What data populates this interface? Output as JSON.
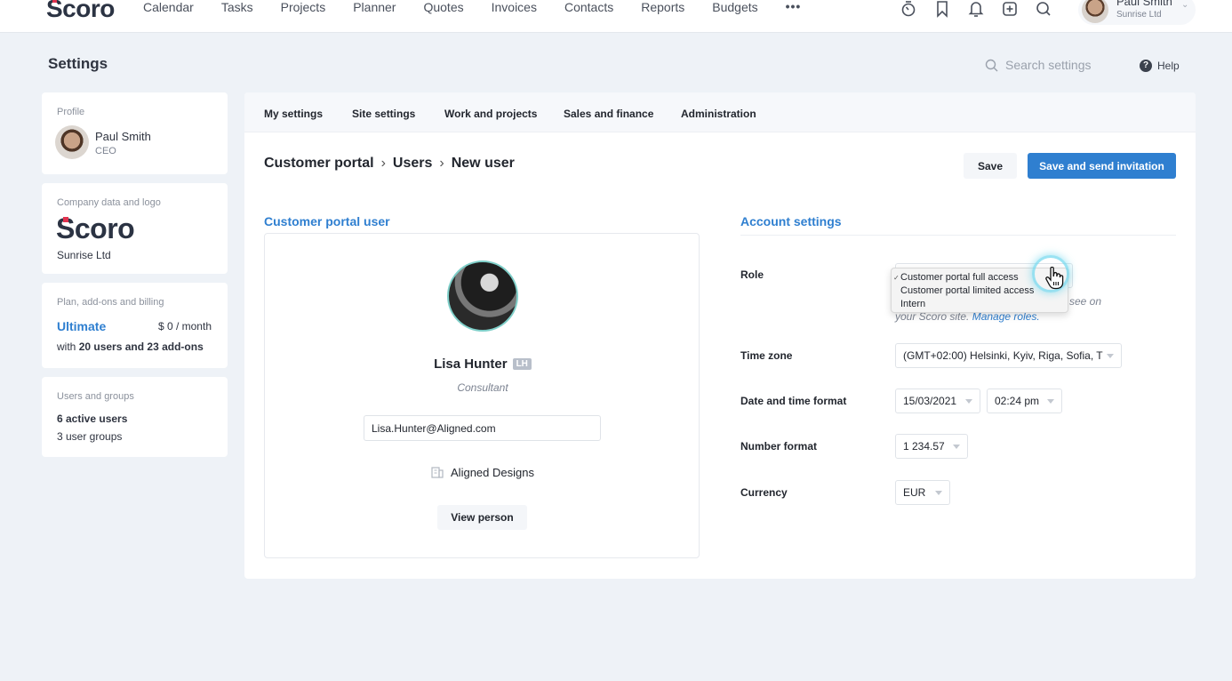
{
  "topnav": {
    "logo": "Scoro",
    "items": [
      "Calendar",
      "Tasks",
      "Projects",
      "Planner",
      "Quotes",
      "Invoices",
      "Contacts",
      "Reports",
      "Budgets"
    ],
    "more": "•••",
    "icons": [
      "stopwatch-icon",
      "bookmark-icon",
      "bell-icon",
      "add-icon",
      "search-icon"
    ],
    "user": {
      "name": "Paul Smith",
      "company": "Sunrise Ltd"
    }
  },
  "header": {
    "title": "Settings",
    "search_placeholder": "Search settings",
    "help": "Help"
  },
  "sidebar": {
    "profile": {
      "label": "Profile",
      "name": "Paul Smith",
      "role": "CEO"
    },
    "company": {
      "label": "Company data and logo",
      "logo": "Scoro",
      "name": "Sunrise Ltd"
    },
    "plan": {
      "label": "Plan, add-ons and billing",
      "name": "Ultimate",
      "price": "$ 0 / month",
      "desc_prefix": "with ",
      "desc_bold": "20 users and 23 add-ons"
    },
    "users": {
      "label": "Users and groups",
      "active": "6 active users",
      "groups": "3 user groups"
    }
  },
  "tabs": [
    "My settings",
    "Site settings",
    "Work and projects",
    "Sales and finance",
    "Administration"
  ],
  "breadcrumb": [
    "Customer portal",
    "Users",
    "New user"
  ],
  "breadcrumb_sep": "›",
  "actions": {
    "save": "Save",
    "save_invite": "Save and send invitation"
  },
  "portal_user": {
    "section_title": "Customer portal user",
    "name": "Lisa Hunter",
    "initials": "LH",
    "role": "Consultant",
    "email": "Lisa.Hunter@Aligned.com",
    "company": "Aligned Designs",
    "view_button": "View person"
  },
  "account": {
    "section_title": "Account settings",
    "role_label": "Role",
    "role_desc_suffix": "see on",
    "role_desc_line2": "your Scoro site. ",
    "manage_roles": "Manage roles.",
    "role_options": [
      "Customer portal full access",
      "Customer portal limited access",
      "Intern"
    ],
    "role_selected_check": "✓",
    "timezone_label": "Time zone",
    "timezone": "(GMT+02:00) Helsinki, Kyiv, Riga, Sofia, T",
    "datetime_label": "Date and time format",
    "date_format": "15/03/2021",
    "time_format": "02:24 pm",
    "number_label": "Number format",
    "number_format": "1 234.57",
    "currency_label": "Currency",
    "currency": "EUR"
  },
  "colors": {
    "accent": "#2f7fd0",
    "brand_mark": "#e0334f",
    "background": "#eef2f7"
  }
}
